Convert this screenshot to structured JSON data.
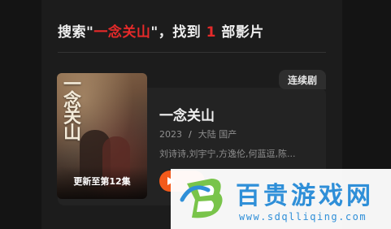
{
  "search_summary": {
    "prefix": "搜索\"",
    "query": "一念关山",
    "middle": "\"，找到",
    "count": "1",
    "suffix": "部影片"
  },
  "result": {
    "badge": "连续剧",
    "poster_title": "一念关山",
    "episodes": "更新至第12集",
    "title": "一念关山",
    "year": "2023",
    "separator": "/",
    "region": "大陆 国产",
    "cast": "刘诗诗,刘宇宁,方逸伦,何蓝逗,陈..."
  },
  "watermark": {
    "name": "百贵游戏网",
    "url": "www.sdqlliqing.com"
  },
  "colors": {
    "accent": "#e52a2a",
    "play_button": "#f35a1b",
    "watermark": "#2f8fd8"
  }
}
